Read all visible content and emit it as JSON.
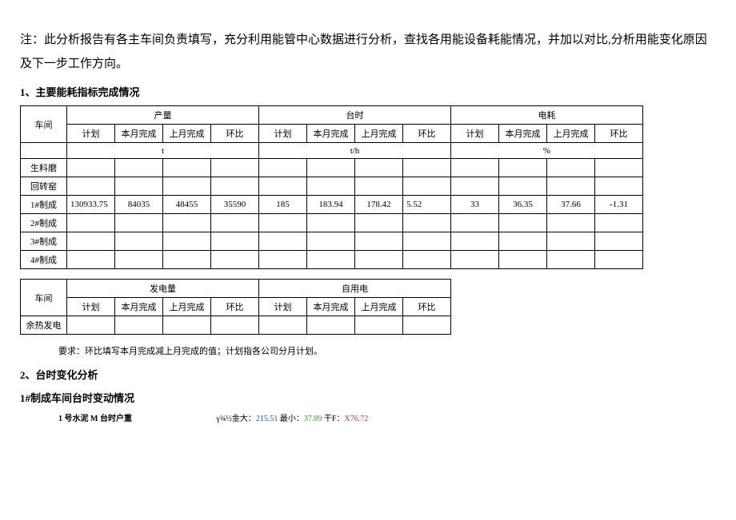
{
  "note": "注：此分析报告有各主车间负责填写，充分利用能管中心数据进行分析，查找各用能设备耗能情况，并加以对比,分析用能变化原因及下一步工作方向。",
  "section1": {
    "title": "1、主要能耗指标完成情况",
    "table1": {
      "headers": {
        "workshop": "车间",
        "group1": "产量",
        "group2": "台时",
        "group3": "电耗",
        "plan": "计划",
        "thisMonth": "本月完成",
        "lastMonth": "上月完成",
        "ratio": "环比",
        "unit1": "t",
        "unit2": "t/h",
        "unit3": "%"
      },
      "rows": [
        {
          "label": "生料磨",
          "plan1": "",
          "tm1": "",
          "lm1": "",
          "r1": "",
          "plan2": "",
          "tm2": "",
          "lm2": "",
          "r2": "",
          "plan3": "",
          "tm3": "",
          "lm3": "",
          "r3": ""
        },
        {
          "label": "回转窑",
          "plan1": "",
          "tm1": "",
          "lm1": "",
          "r1": "",
          "plan2": "",
          "tm2": "",
          "lm2": "",
          "r2": "",
          "plan3": "",
          "tm3": "",
          "lm3": "",
          "r3": ""
        },
        {
          "label": "1#制成",
          "plan1": "130933.75",
          "tm1": "84035",
          "lm1": "48455",
          "r1": "35590",
          "plan2": "185",
          "tm2": "183.94",
          "lm2": "178.42",
          "r2": "5.52",
          "plan3": "33",
          "tm3": "36.35",
          "lm3": "37.66",
          "r3": "-1.31"
        },
        {
          "label": "2#制成",
          "plan1": "",
          "tm1": "",
          "lm1": "",
          "r1": "",
          "plan2": "",
          "tm2": "",
          "lm2": "",
          "r2": "",
          "plan3": "",
          "tm3": "",
          "lm3": "",
          "r3": ""
        },
        {
          "label": "3#制成",
          "plan1": "",
          "tm1": "",
          "lm1": "",
          "r1": "",
          "plan2": "",
          "tm2": "",
          "lm2": "",
          "r2": "",
          "plan3": "",
          "tm3": "",
          "lm3": "",
          "r3": ""
        },
        {
          "label": "4#制成",
          "plan1": "",
          "tm1": "",
          "lm1": "",
          "r1": "",
          "plan2": "",
          "tm2": "",
          "lm2": "",
          "r2": "",
          "plan3": "",
          "tm3": "",
          "lm3": "",
          "r3": ""
        }
      ]
    },
    "table2": {
      "headers": {
        "workshop": "车间",
        "group1": "发电量",
        "group2": "自用电",
        "plan": "计划",
        "thisMonth": "本月完成",
        "lastMonth": "上月完成",
        "ratio": "环比"
      },
      "rows": [
        {
          "label": "余热发电",
          "plan1": "",
          "tm1": "",
          "lm1": "",
          "r1": "",
          "plan2": "",
          "tm2": "",
          "lm2": "",
          "r2": ""
        }
      ]
    },
    "requirement": "要求：环比填写本月完成减上月完成的值；计划指各公司分月计划。"
  },
  "section2": {
    "title": "2、台时变化分析",
    "subtitle": "1#制成车间台时变动情况",
    "stats": {
      "label": "1 号水泥 M 台时户重",
      "prefix": "γ¾½金大：",
      "v1": "215.51",
      "mid": " 最小：",
      "v2": "37.89",
      "mid2": " 干F：",
      "v3": "X76.72"
    }
  }
}
